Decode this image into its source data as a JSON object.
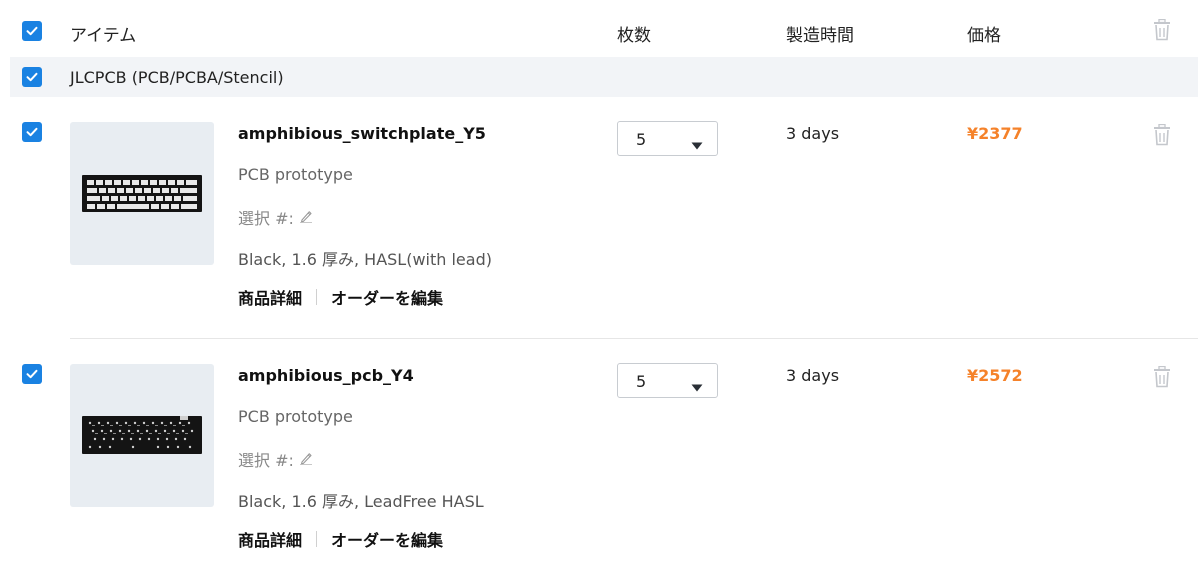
{
  "header": {
    "item_label": "アイテム",
    "qty_label": "枚数",
    "time_label": "製造時間",
    "price_label": "価格",
    "select_all_checked": true
  },
  "group": {
    "title": "JLCPCB (PCB/PCBA/Stencil)",
    "checked": true
  },
  "items": [
    {
      "checked": true,
      "name": "amphibious_switchplate_Y5",
      "type": "PCB prototype",
      "selection_label": "選択 #:",
      "specs": "Black, 1.6 厚み, HASL(with lead)",
      "quantity": "5",
      "build_time": "3 days",
      "price": "¥2377",
      "details_link": "商品詳細",
      "edit_link": "オーダーを編集",
      "thumbnail_icon": "switchplate-thumbnail-icon"
    },
    {
      "checked": true,
      "name": "amphibious_pcb_Y4",
      "type": "PCB prototype",
      "selection_label": "選択 #:",
      "specs": "Black, 1.6 厚み, LeadFree HASL",
      "quantity": "5",
      "build_time": "3 days",
      "price": "¥2572",
      "details_link": "商品詳細",
      "edit_link": "オーダーを編集",
      "thumbnail_icon": "pcb-thumbnail-icon"
    }
  ],
  "colors": {
    "accent": "#1a82e2",
    "price": "#f5822a",
    "group_bg": "#f2f4f7",
    "thumb_bg": "#e8edf2"
  },
  "icons": {
    "checkbox": "check-icon",
    "delete": "trash-icon",
    "edit": "pencil-icon",
    "dropdown": "caret-down-icon"
  }
}
